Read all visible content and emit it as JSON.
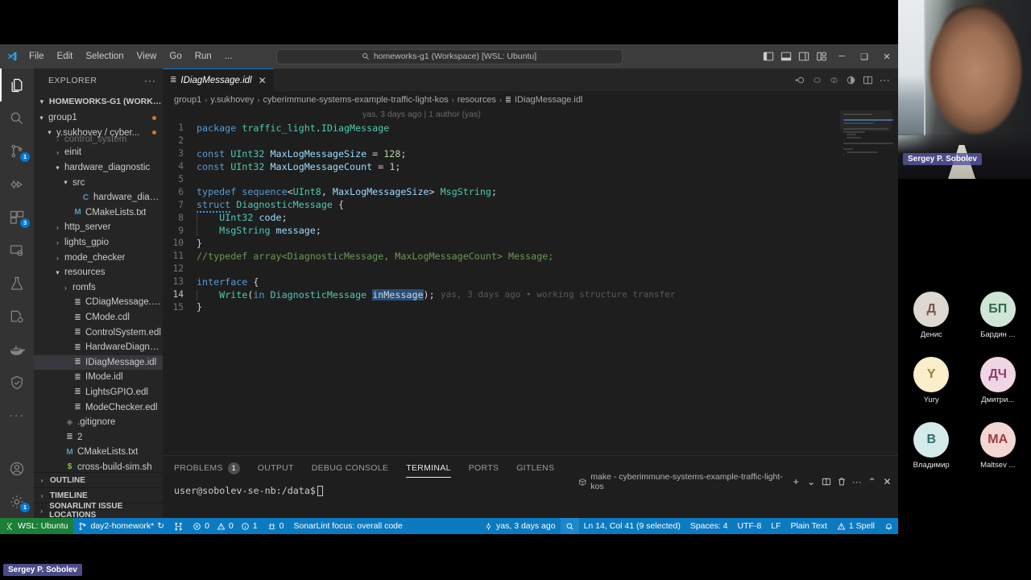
{
  "titlebar": {
    "menu": [
      "File",
      "Edit",
      "Selection",
      "View",
      "Go",
      "Run",
      "..."
    ],
    "back_arrow": "←",
    "forward_arrow": "→",
    "command_center": "homeworks-g1 (Workspace) [WSL: Ubuntu]",
    "layout_icons": [
      "toggle-primary-sidebar",
      "toggle-panel",
      "toggle-secondary-sidebar",
      "customize-layout"
    ],
    "window_minimize": "─",
    "window_maximize": "❑",
    "window_close": "✕"
  },
  "activitybar": {
    "items": [
      {
        "name": "explorer",
        "badge": ""
      },
      {
        "name": "search",
        "badge": ""
      },
      {
        "name": "source-control",
        "badge": "1"
      },
      {
        "name": "run-and-debug",
        "badge": ""
      },
      {
        "name": "extensions",
        "badge": "3"
      },
      {
        "name": "remote-explorer",
        "badge": ""
      },
      {
        "name": "testing",
        "badge": ""
      },
      {
        "name": "sonarlint",
        "badge": ""
      },
      {
        "name": "docker",
        "badge": ""
      },
      {
        "name": "trust",
        "badge": ""
      },
      {
        "name": "more",
        "badge": ""
      }
    ],
    "accounts": "accounts",
    "settings_badge": "1"
  },
  "sidebar": {
    "title": "EXPLORER",
    "more_actions": "···",
    "workspace": "HOMEWORKS-G1 (WORKSPAC...",
    "tree": [
      {
        "indent": 0,
        "chev": "⌄",
        "icon": "",
        "label": "group1",
        "dot": true,
        "type": "folder"
      },
      {
        "indent": 1,
        "chev": "⌄",
        "icon": "",
        "label": "y.sukhovey / cyber...",
        "dot": true,
        "type": "folder"
      },
      {
        "indent": 2,
        "chev": "›",
        "icon": "",
        "label": "control_system",
        "dot": false,
        "type": "folder",
        "clipped": true
      },
      {
        "indent": 2,
        "chev": "›",
        "icon": "",
        "label": "einit",
        "dot": false,
        "type": "folder"
      },
      {
        "indent": 2,
        "chev": "⌄",
        "icon": "",
        "label": "hardware_diagnostic",
        "dot": false,
        "type": "folder"
      },
      {
        "indent": 3,
        "chev": "⌄",
        "icon": "",
        "label": "src",
        "dot": false,
        "type": "folder"
      },
      {
        "indent": 4,
        "chev": "",
        "icon": "C",
        "label": "hardware_diagnosti...",
        "dot": false,
        "type": "c"
      },
      {
        "indent": 3,
        "chev": "",
        "icon": "M",
        "label": "CMakeLists.txt",
        "dot": false,
        "type": "m"
      },
      {
        "indent": 2,
        "chev": "›",
        "icon": "",
        "label": "http_server",
        "dot": false,
        "type": "folder"
      },
      {
        "indent": 2,
        "chev": "›",
        "icon": "",
        "label": "lights_gpio",
        "dot": false,
        "type": "folder"
      },
      {
        "indent": 2,
        "chev": "›",
        "icon": "",
        "label": "mode_checker",
        "dot": false,
        "type": "folder"
      },
      {
        "indent": 2,
        "chev": "⌄",
        "icon": "",
        "label": "resources",
        "dot": false,
        "type": "folder"
      },
      {
        "indent": 3,
        "chev": "›",
        "icon": "",
        "label": "romfs",
        "dot": false,
        "type": "folder"
      },
      {
        "indent": 3,
        "chev": "",
        "icon": "≣",
        "label": "CDiagMessage.cdl",
        "dot": false,
        "type": "idl"
      },
      {
        "indent": 3,
        "chev": "",
        "icon": "≣",
        "label": "CMode.cdl",
        "dot": false,
        "type": "idl"
      },
      {
        "indent": 3,
        "chev": "",
        "icon": "≣",
        "label": "ControlSystem.edl",
        "dot": false,
        "type": "idl"
      },
      {
        "indent": 3,
        "chev": "",
        "icon": "≣",
        "label": "HardwareDiagnostic....",
        "dot": false,
        "type": "idl"
      },
      {
        "indent": 3,
        "chev": "",
        "icon": "≣",
        "label": "IDiagMessage.idl",
        "dot": false,
        "type": "idl",
        "selected": true
      },
      {
        "indent": 3,
        "chev": "",
        "icon": "≣",
        "label": "IMode.idl",
        "dot": false,
        "type": "idl"
      },
      {
        "indent": 3,
        "chev": "",
        "icon": "≣",
        "label": "LightsGPIO.edl",
        "dot": false,
        "type": "idl"
      },
      {
        "indent": 3,
        "chev": "",
        "icon": "≣",
        "label": "ModeChecker.edl",
        "dot": false,
        "type": "idl"
      },
      {
        "indent": 2,
        "chev": "",
        "icon": "◈",
        "label": ".gitignore",
        "dot": false,
        "type": "git"
      },
      {
        "indent": 2,
        "chev": "",
        "icon": "≣",
        "label": "2",
        "dot": false,
        "type": "idl"
      },
      {
        "indent": 2,
        "chev": "",
        "icon": "M",
        "label": "CMakeLists.txt",
        "dot": false,
        "type": "m"
      },
      {
        "indent": 2,
        "chev": "",
        "icon": "$",
        "label": "cross-build-sim.sh",
        "dot": false,
        "type": "sh"
      }
    ],
    "panels": [
      "OUTLINE",
      "TIMELINE",
      "SONARLINT ISSUE LOCATIONS"
    ]
  },
  "editor": {
    "tab": {
      "label": "IDiagMessage.idl",
      "icon": "≣",
      "close": "✕"
    },
    "toolbar_icons": [
      "gitlens-toggle",
      "gitlens-prev",
      "gitlens-next",
      "run-or-preview",
      "split-editor",
      "more-actions"
    ],
    "breadcrumb": [
      "group1",
      "y.sukhovey",
      "cyberimmune-systems-example-traffic-light-kos",
      "resources",
      "IDiagMessage.idl"
    ],
    "blame_header": "yas, 3 days ago | 1 author (yas)",
    "inline_blame": "yas, 3 days ago • working structure transfer",
    "lines": [
      {
        "n": "1",
        "text": "package traffic_light.IDiagMessage"
      },
      {
        "n": "2",
        "text": ""
      },
      {
        "n": "3",
        "text": "const UInt32 MaxLogMessageSize = 128;"
      },
      {
        "n": "4",
        "text": "const UInt32 MaxLogMessageCount = 1;"
      },
      {
        "n": "5",
        "text": ""
      },
      {
        "n": "6",
        "text": "typedef sequence<UInt8, MaxLogMessageSize> MsgString;"
      },
      {
        "n": "7",
        "text": "struct DiagnosticMessage {"
      },
      {
        "n": "8",
        "text": "    UInt32 code;"
      },
      {
        "n": "9",
        "text": "    MsgString message;"
      },
      {
        "n": "10",
        "text": "}"
      },
      {
        "n": "11",
        "text": "//typedef array<DiagnosticMessage, MaxLogMessageCount> Message;"
      },
      {
        "n": "12",
        "text": ""
      },
      {
        "n": "13",
        "text": "interface {"
      },
      {
        "n": "14",
        "text": "    Write(in DiagnosticMessage inMessage);"
      },
      {
        "n": "15",
        "text": "}"
      }
    ],
    "selected_token": "inMessage"
  },
  "panel": {
    "tabs": [
      {
        "label": "PROBLEMS",
        "count": "1",
        "active": false
      },
      {
        "label": "OUTPUT",
        "count": "",
        "active": false
      },
      {
        "label": "DEBUG CONSOLE",
        "count": "",
        "active": false
      },
      {
        "label": "TERMINAL",
        "count": "",
        "active": true
      },
      {
        "label": "PORTS",
        "count": "",
        "active": false
      },
      {
        "label": "GITLENS",
        "count": "",
        "active": false
      }
    ],
    "terminal_title": "make - cyberimmune-systems-example-traffic-light-kos",
    "new_terminal": "+",
    "dropdown": "⌄",
    "split": "split-terminal",
    "kill": "trash",
    "more": "···",
    "maximize": "⌃",
    "close": "✕",
    "prompt": "user@sobolev-se-nb:/data$"
  },
  "statusbar": {
    "remote": "WSL: Ubuntu",
    "branch": "day2-homework*",
    "sync": "↻",
    "errors": "0",
    "warnings": "0",
    "infos": "1",
    "sonar_issues": "0",
    "sonar_focus": "SonarLint focus: overall code",
    "blame": "yas, 3 days ago",
    "search_icon": "search",
    "cursor": "Ln 14, Col 41 (9 selected)",
    "indent": "Spaces: 4",
    "encoding": "UTF-8",
    "eol": "LF",
    "language": "Plain Text",
    "spell": "1 Spell",
    "bell": "notifications"
  },
  "video": {
    "self_name": "Sergey P. Sobolev",
    "call_name_badge": "Sergey P. Sobolev",
    "participants": [
      {
        "initials": "Д",
        "name": "Денис",
        "bg": "#ddd8d2",
        "fg": "#7a5448"
      },
      {
        "initials": "БП",
        "name": "Бардин ...",
        "bg": "#cfe6d6",
        "fg": "#35694a"
      },
      {
        "initials": "Y",
        "name": "Yury",
        "bg": "#fbeecb",
        "fg": "#9a8232"
      },
      {
        "initials": "ДЧ",
        "name": "Дмитри...",
        "bg": "#f0d5e4",
        "fg": "#8d3d6c"
      },
      {
        "initials": "B",
        "name": "Владимир",
        "bg": "#d5ebe9",
        "fg": "#2f6f6a"
      },
      {
        "initials": "MA",
        "name": "Maltsev ...",
        "bg": "#f2d6d3",
        "fg": "#9c3f3a"
      }
    ]
  },
  "colors": {
    "accent": "#0078d4",
    "statusbar_bg": "#0c7ac1",
    "remote_bg": "#1a7f37",
    "editor_bg": "#1e1e1e",
    "sidebar_bg": "#252526",
    "activitybar_bg": "#333333",
    "selection": "#264f78"
  }
}
